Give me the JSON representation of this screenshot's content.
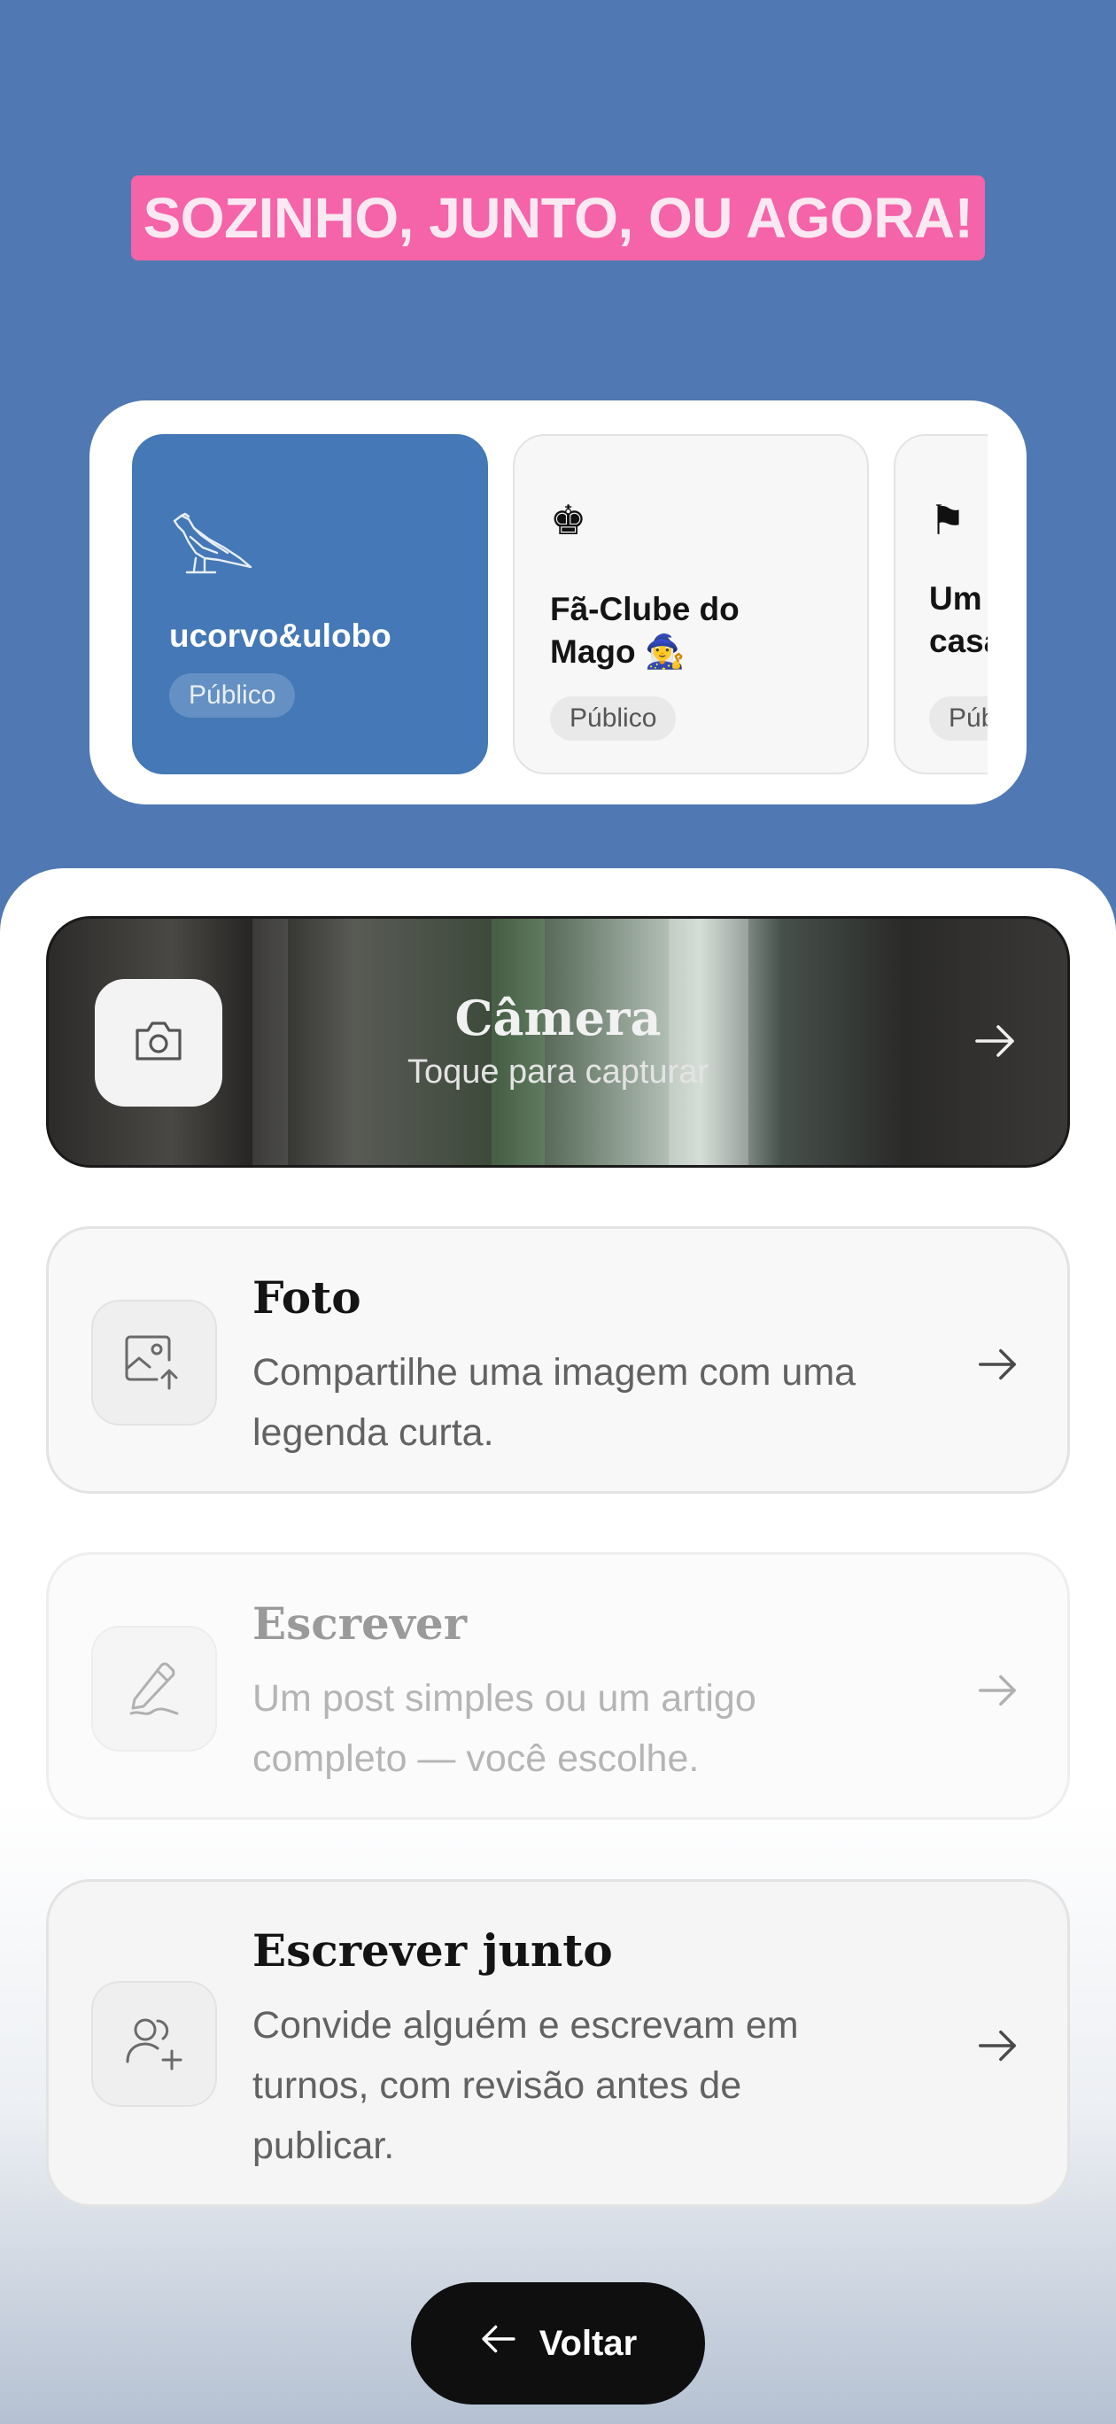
{
  "headline": "SOZINHO, JUNTO, OU AGORA!",
  "communities": [
    {
      "icon": "eagle-icon",
      "name": "ucorvo&ulobo",
      "badge": "Público",
      "selected": true
    },
    {
      "icon": "chess-king-icon",
      "glyph": "♚",
      "name_line1": "Fã-Clube do",
      "name_line2": "Mago 🧙‍♀️",
      "badge": "Público",
      "selected": false
    },
    {
      "icon": "flag-icon",
      "glyph": "⚑",
      "name_line1": "Um",
      "name_line2": "casa",
      "badge": "Púb",
      "selected": false
    }
  ],
  "camera": {
    "title": "Câmera",
    "subtitle": "Toque para capturar",
    "icon": "camera-icon"
  },
  "options": [
    {
      "id": "foto",
      "icon": "image-upload-icon",
      "title": "Foto",
      "desc_line1": "Compartilhe uma imagem com uma",
      "desc_line2": "legenda curta.",
      "enabled": true
    },
    {
      "id": "escrever",
      "icon": "pencil-icon",
      "title": "Escrever",
      "desc_line1": "Um post simples ou um artigo",
      "desc_line2": "completo — você escolhe.",
      "enabled": false
    },
    {
      "id": "junto",
      "icon": "users-add-icon",
      "title": "Escrever junto",
      "desc_line1": "Convide alguém e escrevam em",
      "desc_line2": "turnos, com revisão antes de",
      "desc_line3": "publicar.",
      "enabled": true
    }
  ],
  "back_button": {
    "label": "Voltar"
  },
  "colors": {
    "background": "#5079b4",
    "headline_bg": "#f563a8",
    "selected_card": "#4478b6",
    "back_button": "#0f0f10"
  }
}
